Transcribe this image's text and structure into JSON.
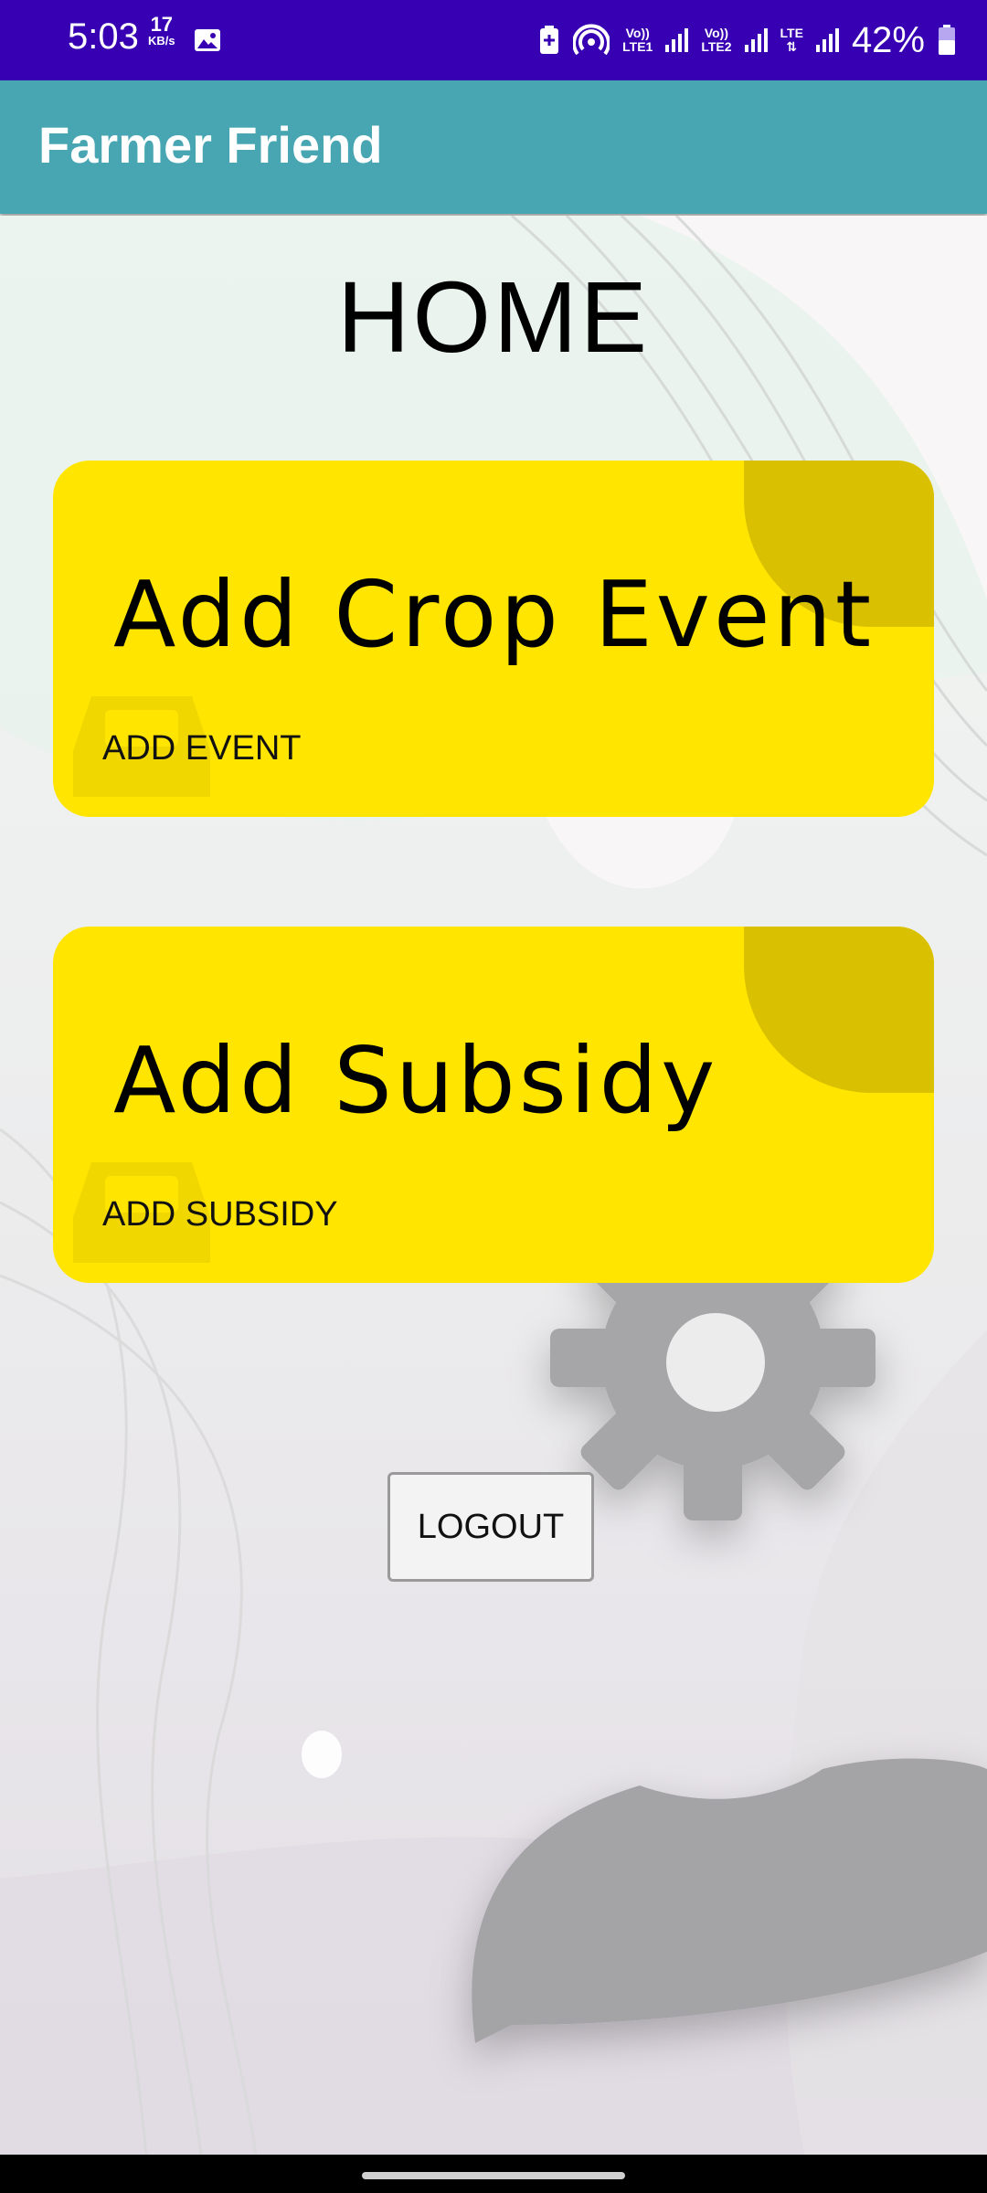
{
  "status_bar": {
    "time": "5:03",
    "speed_value": "17",
    "speed_unit": "KB/s",
    "sim1_label_top": "Vo))",
    "sim1_label_bottom": "LTE1",
    "sim2_label_top": "Vo))",
    "sim2_label_bottom": "LTE2",
    "data_label": "LTE",
    "battery_percent": "42%",
    "icons": [
      "gallery-icon",
      "battery-saver-icon",
      "hotspot-icon",
      "signal-icon",
      "battery-icon"
    ]
  },
  "app_bar": {
    "title": "Farmer Friend",
    "background_color": "#48a6b3"
  },
  "home": {
    "title": "HOME",
    "cards": [
      {
        "title": "Add Crop Event",
        "subtitle": "ADD EVENT"
      },
      {
        "title": "Add Subsidy",
        "subtitle": "ADD SUBSIDY"
      }
    ],
    "card_color": "#ffe500",
    "logout_label": "LOGOUT"
  }
}
